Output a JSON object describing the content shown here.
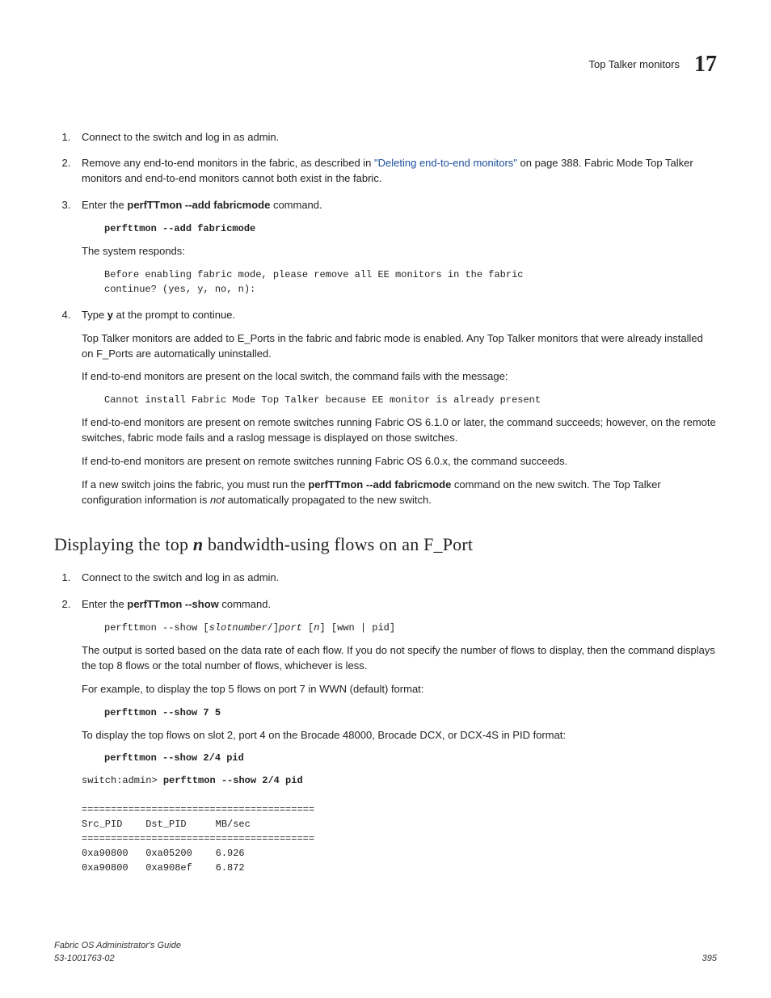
{
  "header": {
    "title": "Top Talker monitors",
    "chapter": "17"
  },
  "steps_a": {
    "s1": "Connect to the switch and log in as admin.",
    "s2_pre": "Remove any end-to-end monitors in the fabric, as described in ",
    "s2_link": "\"Deleting end-to-end monitors\"",
    "s2_post": " on page 388. Fabric Mode Top Talker monitors and end-to-end monitors cannot both exist in the fabric.",
    "s3_pre": "Enter the ",
    "s3_cmd": "perfTTmon --add fabricmode",
    "s3_post": " command.",
    "s3_code": "perfttmon --add fabricmode",
    "s3_resp_label": "The system responds:",
    "s3_resp_code": "Before enabling fabric mode, please remove all EE monitors in the fabric\ncontinue? (yes, y, no, n):",
    "s4_pre": "Type ",
    "s4_key": "y",
    "s4_post": " at the prompt to continue.",
    "s4_p1": "Top Talker monitors are added to E_Ports in the fabric and fabric mode is enabled. Any Top Talker monitors that were already installed on F_Ports are automatically uninstalled.",
    "s4_p2": "If end-to-end monitors are present on the local switch, the command fails with the message:",
    "s4_code": "Cannot install Fabric Mode Top Talker because EE monitor is already present",
    "s4_p3": "If end-to-end monitors are present on remote switches running Fabric OS 6.1.0 or later, the command succeeds; however, on the remote switches, fabric mode fails and a raslog message is displayed on those switches.",
    "s4_p4": "If end-to-end monitors are present on remote switches running Fabric OS 6.0.x, the command succeeds.",
    "s4_p5_pre": "If a new switch joins the fabric, you must run the ",
    "s4_p5_cmd": "perfTTmon --add fabricmode",
    "s4_p5_mid": " command on the new switch. The Top Talker configuration information is ",
    "s4_p5_not": "not",
    "s4_p5_post": " automatically propagated to the new switch."
  },
  "section_b": {
    "heading_pre": "Displaying the top ",
    "heading_n": "n",
    "heading_post": " bandwidth-using flows on an F_Port"
  },
  "steps_b": {
    "s1": "Connect to the switch and log in as admin.",
    "s2_pre": "Enter the ",
    "s2_cmd": "perfTTmon --show",
    "s2_post": " command.",
    "s2_syntax_plain1": "perfttmon --show [",
    "s2_syntax_ital1": "slotnumber",
    "s2_syntax_plain2": "/]",
    "s2_syntax_ital2": "port",
    "s2_syntax_plain3": " [",
    "s2_syntax_ital3": "n",
    "s2_syntax_plain4": "] [wwn | pid]",
    "s2_p1": "The output is sorted based on the data rate of each flow. If you do not specify the number of flows to display, then the command displays the top 8 flows or the total number of flows, whichever is less.",
    "s2_p2": "For example, to display the top 5 flows on port 7 in WWN (default) format:",
    "s2_code2": "perfttmon --show 7 5",
    "s2_p3": "To display the top flows on slot 2, port 4 on the Brocade 48000, Brocade DCX, or DCX-4S in PID format:",
    "s2_code3": "perfttmon --show 2/4 pid",
    "s2_prompt": "switch:admin> ",
    "s2_prompt_cmd": "perfttmon --show 2/4 pid",
    "s2_output": "========================================\nSrc_PID    Dst_PID     MB/sec\n========================================\n0xa90800   0xa05200    6.926\n0xa90800   0xa908ef    6.872"
  },
  "footer": {
    "book": "Fabric OS Administrator's Guide",
    "docnum": "53-1001763-02",
    "page": "395"
  }
}
